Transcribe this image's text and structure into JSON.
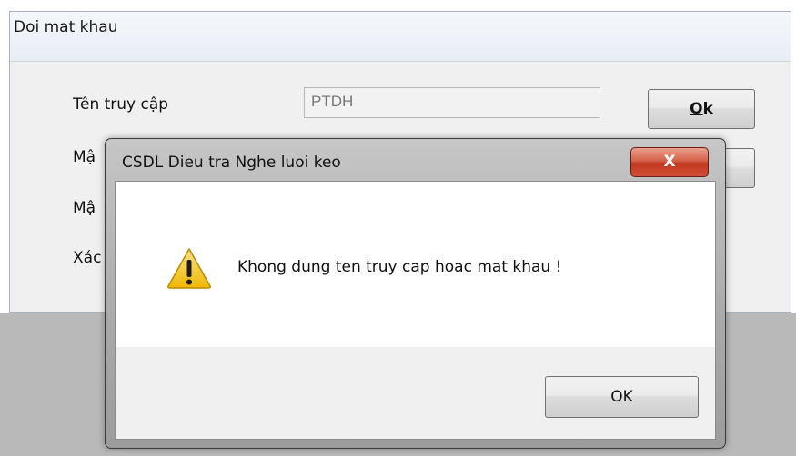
{
  "form": {
    "title": "Doi mat khau",
    "labels": [
      "Tên truy cập",
      "Mậ",
      "Mậ",
      "Xác"
    ],
    "username_value": "PTDH",
    "ok_button_accel": "O",
    "ok_button_rest": "k"
  },
  "dialog": {
    "title": "CSDL Dieu tra Nghe luoi keo",
    "close_glyph": "X",
    "message": "Khong dung ten truy cap hoac mat khau !",
    "ok_label": "OK",
    "icon": "warning-icon"
  },
  "colors": {
    "close_button": "#c73b22",
    "warning_icon": "#f2c21a",
    "window_bg": "#f0f0f0"
  }
}
